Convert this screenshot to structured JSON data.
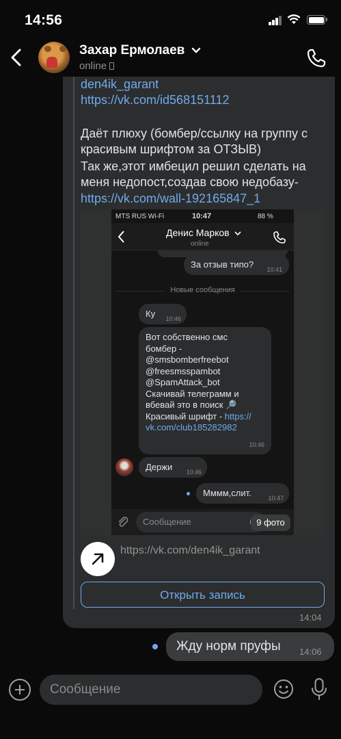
{
  "status_bar": {
    "time": "14:56"
  },
  "header": {
    "contact_name": "Захар Ермолаев",
    "status": "online",
    "icons": {
      "back": "back-icon",
      "chevron": "chevron-down-icon",
      "call": "phone-icon",
      "device": "phone-device-icon"
    }
  },
  "message": {
    "line1": "den4ik_garant",
    "line2": "https://vk.com/id568151112",
    "para1": "Даёт плюху (бомбер/ссылку на группу с",
    "para2": "красивым шрифтом за ОТЗЫВ)",
    "para3": "Так же,этот имбецил решил сделать на",
    "para4": "меня недопост,создав свою недобазу-",
    "wall_link": "https://vk.com/wall-192165847_1",
    "attached_screenshot": {
      "status_left": "MTS RUS Wi-Fi",
      "status_time": "10:47",
      "status_battery": "88 %",
      "contact_name": "Денис Марков",
      "contact_status": "online",
      "bubble_q": "За отзыв типо?",
      "bubble_q_time": "10:41",
      "separator": "Новые сообщения",
      "ku": "Ку",
      "ku_time": "10:46",
      "long_lines": [
        "Вот собственно смс",
        "бомбер -",
        "@smsbomberfreebot",
        "@freesmsspambot",
        "@SpamAttack_bot",
        "Скачивай телеграмм и",
        "вбевай это в поиск 🔎"
      ],
      "font_prefix": "Красивый шрифт - ",
      "font_link_1": "https://",
      "font_link_2": "vk.com/club185282982",
      "long_time": "10:46",
      "derzhi": "Держи",
      "derzhi_time": "10:46",
      "mmm": "Мммм,слит.",
      "mmm_time": "10:47",
      "input_placeholder": "Сообщение",
      "photo_badge": "9 фото"
    },
    "share_url": "https://vk.com/den4ik_garant",
    "open_button": "Открыть запись",
    "time": "14:04"
  },
  "outgoing": {
    "text": "Жду норм пруфы",
    "time": "14:06"
  },
  "composer": {
    "placeholder": "Сообщение",
    "icons": {
      "attach": "plus-icon",
      "emoji": "smile-icon",
      "voice": "microphone-icon"
    }
  },
  "colors": {
    "background": "#0a0a0a",
    "bubble": "#2c2d2e",
    "link": "#71aaeb",
    "muted": "#939393"
  }
}
